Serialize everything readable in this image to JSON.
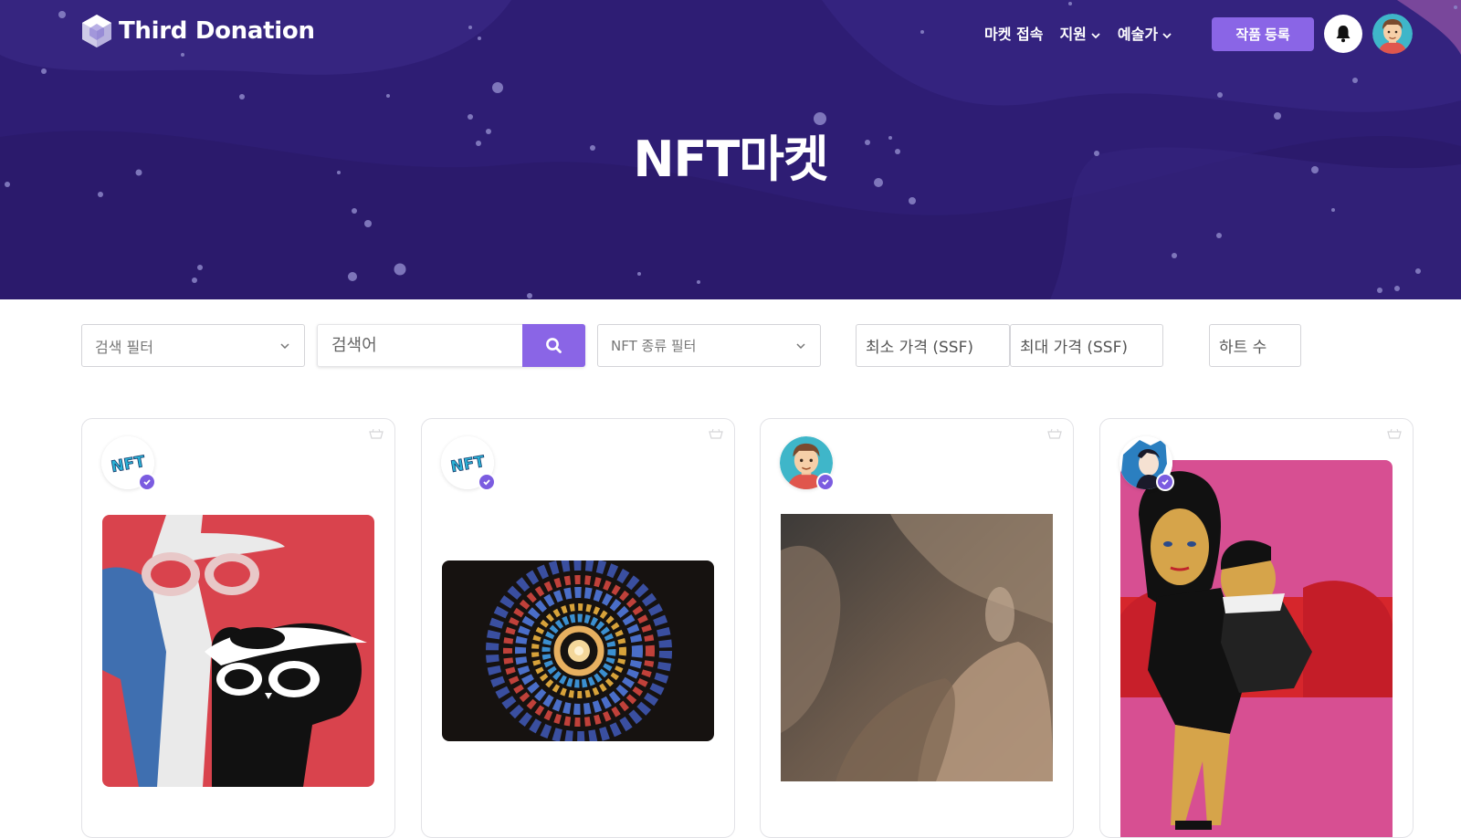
{
  "brand": {
    "name": "Third Donation"
  },
  "nav": {
    "items": [
      {
        "label": "마켓 접속",
        "has_dropdown": false
      },
      {
        "label": "지원",
        "has_dropdown": true
      },
      {
        "label": "예술가",
        "has_dropdown": true
      }
    ],
    "register_button": "작품 등록",
    "bell_icon": "bell-icon",
    "avatar_icon": "user-avatar"
  },
  "hero": {
    "title": "NFT마켓"
  },
  "filters": {
    "search_filter": "검색 필터",
    "search_placeholder": "검색어",
    "search_icon": "search-icon",
    "nft_type_filter": "NFT 종류 필터",
    "min_price": "최소 가격 (SSF)",
    "max_price": "최대 가격 (SSF)",
    "hearts": "하트 수"
  },
  "colors": {
    "hero_bg": "#2d1c72",
    "accent": "#8a65e6",
    "verified": "#7b5ce0"
  },
  "cards": [
    {
      "owner_icon": "nft-logo-avatar",
      "artwork": "cats-with-sunglasses-painting",
      "verified": true
    },
    {
      "owner_icon": "nft-logo-avatar",
      "artwork": "stained-glass-spiral",
      "verified": true
    },
    {
      "owner_icon": "cartoon-man-avatar",
      "artwork": "hands-pottery-photo",
      "verified": true
    },
    {
      "owner_icon": "anime-character-avatar",
      "artwork": "mother-child-pink-painting",
      "verified": true
    }
  ]
}
